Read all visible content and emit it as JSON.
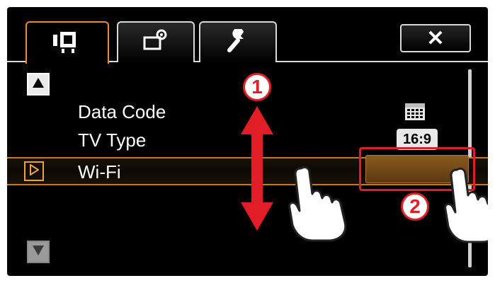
{
  "tabs": [
    {
      "name": "movie-menu",
      "icon": "movie-camera-icon",
      "active": true
    },
    {
      "name": "recording-setup",
      "icon": "camera-settings-icon",
      "active": false
    },
    {
      "name": "system-setup",
      "icon": "wrench-icon",
      "active": false
    }
  ],
  "close_button": {
    "label": "✕",
    "icon": "close-icon"
  },
  "menu_items": [
    {
      "label": "Data Code",
      "value_icon": "calendar-icon"
    },
    {
      "label": "TV Type",
      "value": "16:9"
    },
    {
      "label": "Wi-Fi",
      "value": "",
      "selected": true
    }
  ],
  "annotations": {
    "step1": "1",
    "step2": "2"
  },
  "colors": {
    "accent": "#f08a2b",
    "highlight_border": "#c97a1f",
    "callout": "#e11d25"
  }
}
